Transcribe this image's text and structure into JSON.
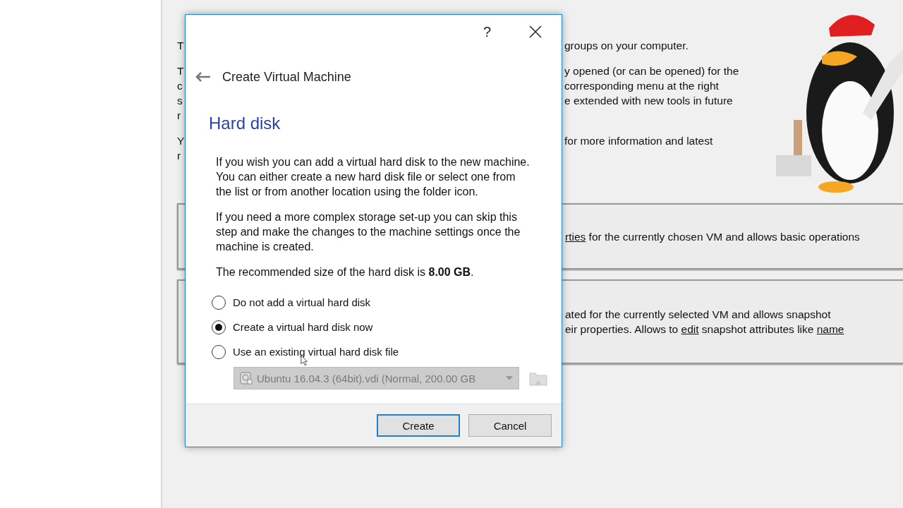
{
  "background": {
    "intro_paragraphs": [
      [
        {
          "left": "T",
          "right": "groups on your computer."
        }
      ],
      [
        {
          "left": "T",
          "right": "y opened (or can be opened) for the"
        },
        {
          "left": "c",
          "right": "corresponding menu at the right"
        },
        {
          "left": "s",
          "right": "e extended with new tools in future"
        },
        {
          "left": "r"
        }
      ],
      [
        {
          "left": "Y",
          "right": "for more information and latest"
        },
        {
          "left": "r"
        }
      ]
    ],
    "panels": [
      {
        "lines": [
          [
            {
              "text": "rties",
              "link": true
            },
            {
              "text": " for the currently chosen VM and allows basic operations",
              "link": false
            }
          ]
        ]
      },
      {
        "lines": [
          [
            {
              "text": "ated for the currently selected VM and allows snapshot",
              "link": false
            }
          ],
          [
            {
              "text": "eir properties. Allows to ",
              "link": false
            },
            {
              "text": "edit",
              "link": true
            },
            {
              "text": " snapshot attributes like ",
              "link": false
            },
            {
              "text": "name",
              "link": true
            }
          ]
        ]
      }
    ]
  },
  "dialog": {
    "help": "?",
    "title": "Create Virtual Machine",
    "heading": "Hard disk",
    "paragraphs": [
      [
        "If you wish you can add a virtual hard disk to the new machine.",
        "You can either create a new hard disk file or select one from",
        "the list or from another location using the folder icon."
      ],
      [
        "If you need a more complex storage set-up you can skip this",
        "step and make the changes to the machine settings once the",
        "machine is created."
      ],
      [
        "The recommended size of the hard disk is **8.00 GB**."
      ]
    ],
    "options": [
      {
        "label": "Do not add a virtual hard disk",
        "selected": false
      },
      {
        "label": "Create a virtual hard disk now",
        "selected": true
      },
      {
        "label": "Use an existing virtual hard disk file",
        "selected": false
      }
    ],
    "disk_select": {
      "value": "Ubuntu 16.04.3 (64bit).vdi (Normal, 200.00 GB",
      "disabled": true
    },
    "buttons": [
      {
        "label": "Create",
        "default": true
      },
      {
        "label": "Cancel",
        "default": false
      }
    ]
  }
}
